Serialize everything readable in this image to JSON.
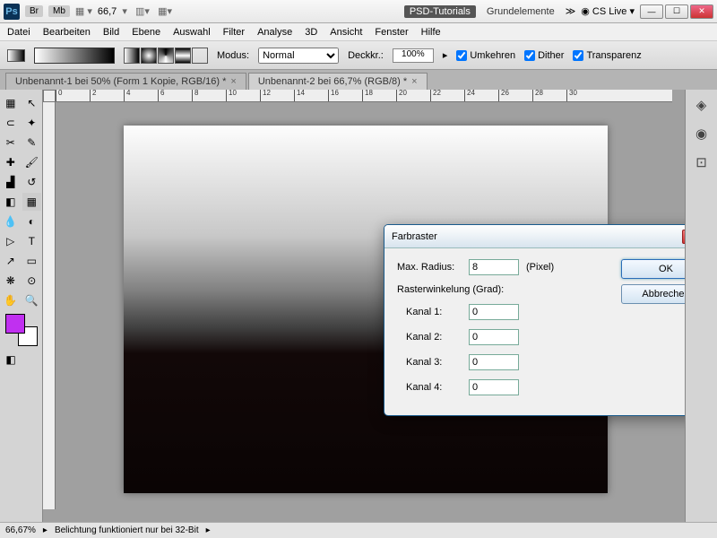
{
  "titlebar": {
    "chips": [
      "Br",
      "Mb"
    ],
    "zoom": "66,7",
    "workspace_active": "PSD-Tutorials",
    "workspace_other": "Grundelemente",
    "cslive": "CS Live"
  },
  "menu": [
    "Datei",
    "Bearbeiten",
    "Bild",
    "Ebene",
    "Auswahl",
    "Filter",
    "Analyse",
    "3D",
    "Ansicht",
    "Fenster",
    "Hilfe"
  ],
  "optbar": {
    "mode_label": "Modus:",
    "mode_value": "Normal",
    "deck_label": "Deckkr.:",
    "deck_value": "100%",
    "umkehren": "Umkehren",
    "dither": "Dither",
    "transparenz": "Transparenz"
  },
  "doctabs": [
    "Unbenannt-1 bei 50% (Form 1 Kopie, RGB/16) *",
    "Unbenannt-2 bei 66,7% (RGB/8) *"
  ],
  "ruler_marks": [
    "0",
    "2",
    "4",
    "6",
    "8",
    "10",
    "12",
    "14",
    "16",
    "18",
    "20",
    "22",
    "24",
    "26",
    "28",
    "30"
  ],
  "dialog": {
    "title": "Farbraster",
    "max_radius_label": "Max. Radius:",
    "max_radius_value": "8",
    "pixel_label": "(Pixel)",
    "raster_label": "Rasterwinkelung (Grad):",
    "channels": [
      {
        "label": "Kanal 1:",
        "value": "0"
      },
      {
        "label": "Kanal 2:",
        "value": "0"
      },
      {
        "label": "Kanal 3:",
        "value": "0"
      },
      {
        "label": "Kanal 4:",
        "value": "0"
      }
    ],
    "ok": "OK",
    "cancel": "Abbrechen"
  },
  "status": {
    "zoom": "66,67%",
    "msg": "Belichtung funktioniert nur bei 32-Bit"
  }
}
